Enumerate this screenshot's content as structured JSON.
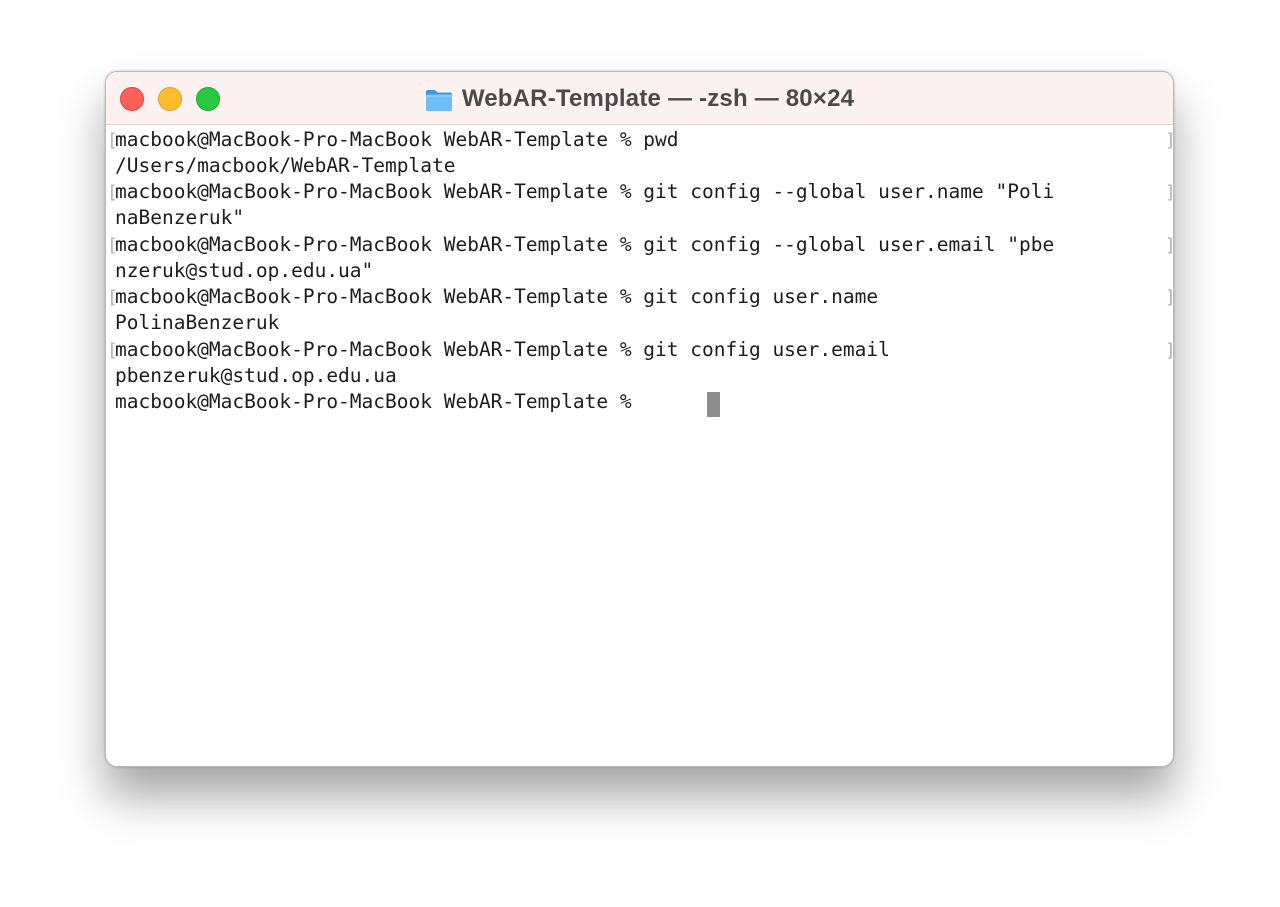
{
  "window": {
    "title": "WebAR-Template — -zsh — 80×24",
    "folder_icon": "folder-icon"
  },
  "colors": {
    "titlebar_bg": "#fdf2f1",
    "close": "#fe5f57",
    "minimize": "#febc2e",
    "zoom": "#28c840",
    "cursor": "#8d8d8d",
    "text": "#1c1c1c"
  },
  "terminal": {
    "lines": [
      "macbook@MacBook-Pro-MacBook WebAR-Template % pwd",
      "/Users/macbook/WebAR-Template",
      "macbook@MacBook-Pro-MacBook WebAR-Template % git config --global user.name \"Poli",
      "naBenzeruk\"",
      "macbook@MacBook-Pro-MacBook WebAR-Template % git config --global user.email \"pbe",
      "nzeruk@stud.op.edu.ua\"",
      "macbook@MacBook-Pro-MacBook WebAR-Template % git config user.name",
      "PolinaBenzeruk",
      "macbook@MacBook-Pro-MacBook WebAR-Template % git config user.email",
      "pbenzeruk@stud.op.edu.ua",
      "macbook@MacBook-Pro-MacBook WebAR-Template % "
    ],
    "bracket_left": "[",
    "bracket_right": "]"
  }
}
